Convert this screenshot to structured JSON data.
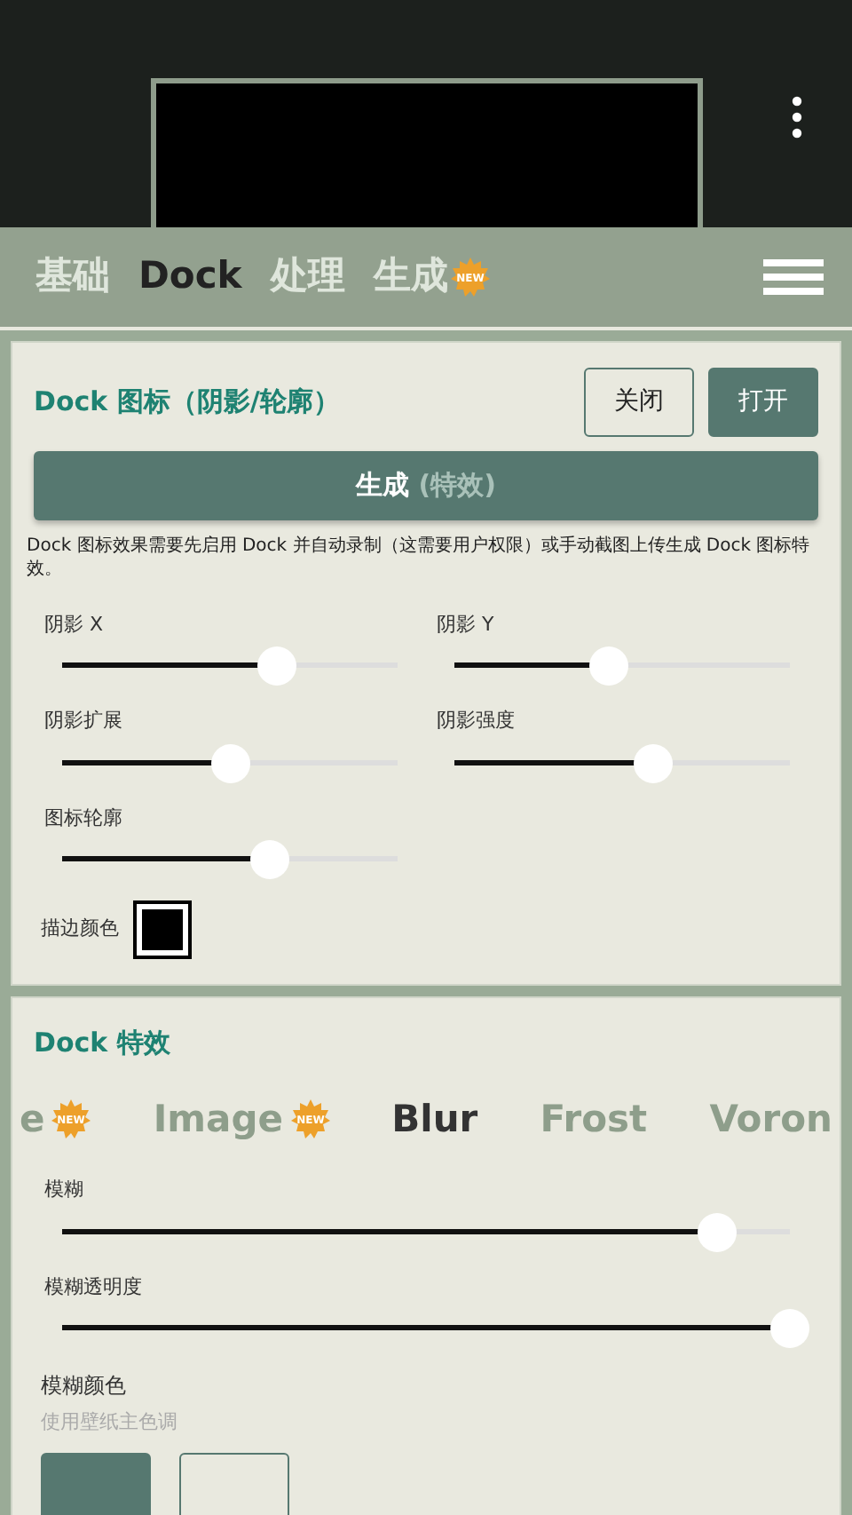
{
  "tabs": [
    {
      "label": "基础",
      "selected": false
    },
    {
      "label": "Dock",
      "selected": true
    },
    {
      "label": "处理",
      "selected": false
    },
    {
      "label": "生成",
      "selected": false,
      "badge": "NEW"
    }
  ],
  "icon_card": {
    "title": "Dock 图标（阴影/轮廓）",
    "toggles": [
      {
        "label": "关闭",
        "selected": false
      },
      {
        "label": "打开",
        "selected": true
      }
    ],
    "generate": {
      "label": "生成",
      "hint": "(特效)"
    },
    "note": "Dock 图标效果需要先启用 Dock 并自动录制（这需要用户权限）或手动截图上传生成 Dock 图标特效。",
    "sliders": [
      {
        "label": "阴影 X",
        "level": 0.64
      },
      {
        "label": "阴影 Y",
        "level": 0.46
      },
      {
        "label": "阴影扩展",
        "level": 0.5
      },
      {
        "label": "阴影强度",
        "level": 0.59
      },
      {
        "label": "图标轮廓",
        "level": 0.62
      }
    ],
    "stroke_color": {
      "label": "描边颜色",
      "color": "#000000"
    }
  },
  "effects_card": {
    "title": "Dock 特效",
    "effects": [
      {
        "label": "e",
        "selected": false,
        "badge": "NEW"
      },
      {
        "label": "Image",
        "selected": false,
        "badge": "NEW"
      },
      {
        "label": "Blur",
        "selected": true
      },
      {
        "label": "Frost",
        "selected": false
      },
      {
        "label": "Voron",
        "selected": false
      }
    ],
    "sliders": [
      {
        "label": "模糊",
        "level": 0.9
      },
      {
        "label": "模糊透明度",
        "level": 1
      }
    ],
    "color_label": "模糊颜色",
    "color_hint": "使用壁纸主色调",
    "buttons": [
      {
        "selected": true
      },
      {
        "selected": false
      }
    ]
  }
}
